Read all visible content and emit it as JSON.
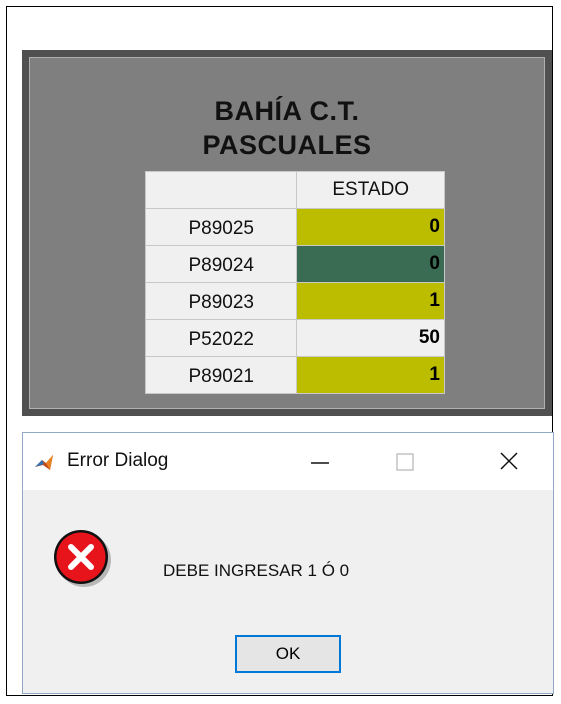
{
  "panel": {
    "title_line1": "BAHÍA C.T.",
    "title_line2": "PASCUALES"
  },
  "table": {
    "header": "ESTADO",
    "rows": [
      {
        "label": "P89025",
        "value": "0",
        "color": "#bdbd00"
      },
      {
        "label": "P89024",
        "value": "0",
        "color": "#3a6b53"
      },
      {
        "label": "P89023",
        "value": "1",
        "color": "#bdbd00"
      },
      {
        "label": "P52022",
        "value": "50",
        "color": "#f0f0f0"
      },
      {
        "label": "P89021",
        "value": "1",
        "color": "#bdbd00"
      }
    ]
  },
  "dialog": {
    "title": "Error Dialog",
    "message": "DEBE INGRESAR 1 Ó 0",
    "ok_label": "OK",
    "icon": "error-icon",
    "error_color": "#e8141c"
  }
}
